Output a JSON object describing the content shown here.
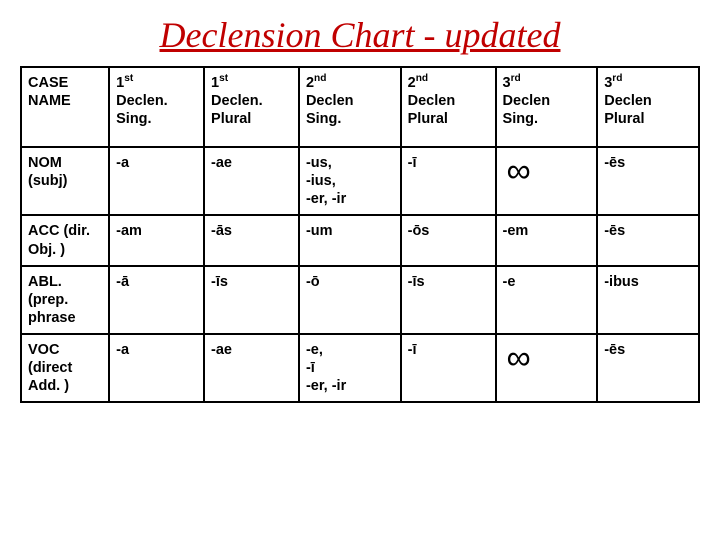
{
  "title": "Declension Chart - updated",
  "headers": {
    "case": "CASE NAME",
    "c1": {
      "ord": "1",
      "sup": "st",
      "decl": "Declen.",
      "num": "Sing."
    },
    "c2": {
      "ord": "1",
      "sup": "st",
      "decl": "Declen.",
      "num": "Plural"
    },
    "c3": {
      "ord": "2",
      "sup": "nd",
      "decl": "Declen",
      "num": "Sing."
    },
    "c4": {
      "ord": "2",
      "sup": "nd",
      "decl": "Declen",
      "num": "Plural"
    },
    "c5": {
      "ord": "3",
      "sup": "rd",
      "decl": "Declen",
      "num": "Sing."
    },
    "c6": {
      "ord": "3",
      "sup": "rd",
      "decl": "Declen",
      "num": "Plural"
    }
  },
  "rows": [
    {
      "label": "NOM (subj)",
      "cells": [
        "-a",
        "-ae",
        "-us,\n-ius,\n-er, -ir",
        "-ī",
        "∞",
        "-ēs"
      ]
    },
    {
      "label": "ACC (dir. Obj. )",
      "cells": [
        "-am",
        "-ās",
        "-um",
        "-ōs",
        "-em",
        "-ēs"
      ]
    },
    {
      "label": "ABL. (prep. phrase",
      "cells": [
        "-ā",
        "-īs",
        "-ō",
        "-īs",
        "-e",
        "-ibus"
      ]
    },
    {
      "label": "VOC (direct Add. )",
      "cells": [
        "-a",
        "-ae",
        "-e,\n-ī\n-er, -ir",
        "-ī",
        "∞",
        "-ēs"
      ]
    }
  ]
}
